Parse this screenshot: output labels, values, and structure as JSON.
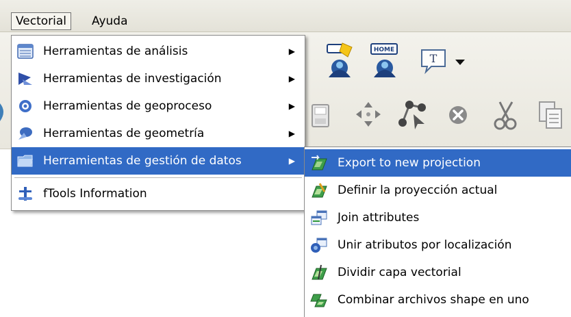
{
  "menubar": {
    "items": [
      {
        "label": "Vectorial"
      },
      {
        "label": "Ayuda"
      }
    ]
  },
  "toolbar": {
    "home_badge_label": "HOME",
    "text_tool_glyph": "T"
  },
  "vectorial_menu": {
    "items": [
      {
        "label": "Herramientas de análisis",
        "icon": "table-icon",
        "arrow": "▶"
      },
      {
        "label": "Herramientas de investigación",
        "icon": "investigation-icon",
        "arrow": "▶"
      },
      {
        "label": "Herramientas de geoproceso",
        "icon": "geoprocess-icon",
        "arrow": "▶"
      },
      {
        "label": "Herramientas de geometría",
        "icon": "geometry-icon",
        "arrow": "▶"
      },
      {
        "label": "Herramientas de gestión de datos",
        "icon": "folder-icon",
        "arrow": "▶"
      },
      {
        "label": "fTools Information",
        "icon": "ftools-icon"
      }
    ]
  },
  "data_management_submenu": {
    "items": [
      {
        "label": "Export to new projection",
        "icon": "export-projection-icon"
      },
      {
        "label": "Definir la proyección actual",
        "icon": "define-projection-icon"
      },
      {
        "label": "Join attributes",
        "icon": "join-attributes-icon"
      },
      {
        "label": "Unir atributos por localización",
        "icon": "spatial-join-icon"
      },
      {
        "label": "Dividir capa vectorial",
        "icon": "split-layer-icon"
      },
      {
        "label": "Combinar archivos shape en uno",
        "icon": "merge-shapefiles-icon"
      }
    ]
  },
  "colors": {
    "highlight": "#316ac5",
    "menu_border": "#8a8a8a",
    "menubar_bg": "#efeee7"
  }
}
